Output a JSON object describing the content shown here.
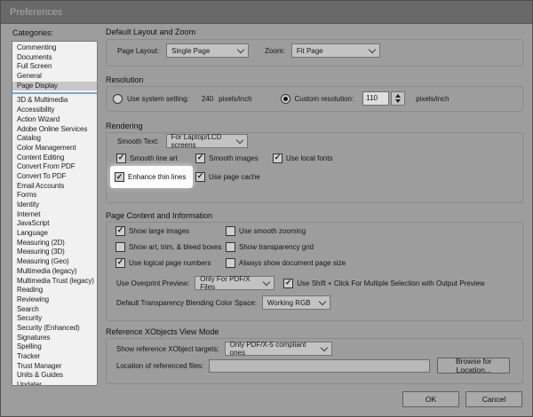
{
  "window": {
    "title": "Preferences"
  },
  "icons": {
    "checkmark": "✓"
  },
  "sidebar": {
    "label": "Categories:",
    "selected": "Page Display",
    "top_items": [
      "Commenting",
      "Documents",
      "Full Screen",
      "General",
      "Page Display"
    ],
    "bottom_items": [
      "3D & Multimedia",
      "Accessibility",
      "Action Wizard",
      "Adobe Online Services",
      "Catalog",
      "Color Management",
      "Content Editing",
      "Convert From PDF",
      "Convert To PDF",
      "Email Accounts",
      "Forms",
      "Identity",
      "Internet",
      "JavaScript",
      "Language",
      "Measuring (2D)",
      "Measuring (3D)",
      "Measuring (Geo)",
      "Multimedia (legacy)",
      "Multimedia Trust (legacy)",
      "Reading",
      "Reviewing",
      "Search",
      "Security",
      "Security (Enhanced)",
      "Signatures",
      "Spelling",
      "Tracker",
      "Trust Manager",
      "Units & Guides",
      "Updater"
    ]
  },
  "layout_zoom": {
    "title": "Default Layout and Zoom",
    "page_layout_label": "Page Layout:",
    "page_layout_value": "Single Page",
    "zoom_label": "Zoom:",
    "zoom_value": "Fit Page"
  },
  "resolution": {
    "title": "Resolution",
    "use_system_label": "Use system setting:",
    "use_system_selected": false,
    "system_dpi": "240",
    "system_unit": "pixels/inch",
    "custom_label": "Custom resolution:",
    "custom_selected": true,
    "custom_dpi": "110",
    "custom_unit": "pixels/inch"
  },
  "rendering": {
    "title": "Rendering",
    "smooth_text_label": "Smooth Text:",
    "smooth_text_value": "For Laptop/LCD screens",
    "smooth_line_art": {
      "label": "Smooth line art",
      "checked": true
    },
    "smooth_images": {
      "label": "Smooth images",
      "checked": true
    },
    "use_local_fonts": {
      "label": "Use local fonts",
      "checked": true
    },
    "enhance_thin_lines": {
      "label": "Enhance thin lines",
      "checked": true,
      "highlighted": true
    },
    "use_page_cache": {
      "label": "Use page cache",
      "checked": true
    }
  },
  "page_content": {
    "title": "Page Content and Information",
    "show_large_images": {
      "label": "Show large images",
      "checked": true
    },
    "use_smooth_zooming": {
      "label": "Use smooth zooming",
      "checked": false
    },
    "show_art_trim_bleed": {
      "label": "Show art, trim, & bleed boxes",
      "checked": false
    },
    "show_transparency_grid": {
      "label": "Show transparency grid",
      "checked": false
    },
    "use_logical_page_numbers": {
      "label": "Use logical page numbers",
      "checked": true
    },
    "always_show_page_size": {
      "label": "Always show document page size",
      "checked": false
    },
    "overprint_label": "Use Overprint Preview:",
    "overprint_value": "Only For PDF/X Files",
    "shift_click": {
      "label": "Use Shift + Click For Multiple Selection with Output Preview",
      "checked": true
    },
    "blend_label": "Default Transparency Blending Color Space:",
    "blend_value": "Working RGB"
  },
  "xobjects": {
    "title": "Reference XObjects View Mode",
    "targets_label": "Show reference XObject targets:",
    "targets_value": "Only PDF/X-5 compliant ones",
    "location_label": "Location of referenced files:",
    "location_value": "",
    "browse_label": "Browse for Location..."
  },
  "footer": {
    "ok_label": "OK",
    "cancel_label": "Cancel"
  },
  "colors": {
    "dialog_bg": "#9d9d9d",
    "titlebar_bg": "#696969",
    "list_bg": "#f1f1f1",
    "selected_item_bg": "#c7c7c7",
    "separator_blue": "#79a7cb",
    "highlight_box": "#fcfcfc"
  }
}
